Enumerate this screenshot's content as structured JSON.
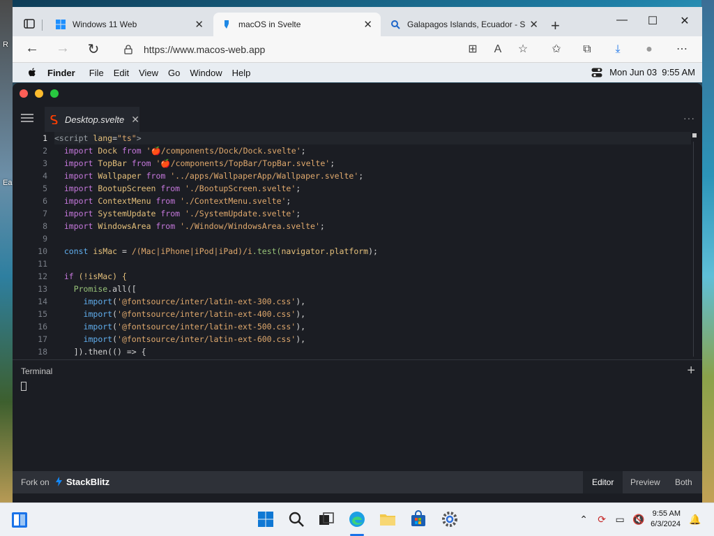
{
  "browser": {
    "tabs": [
      {
        "title": "Windows 11 Web",
        "favicon": "windows-logo-icon"
      },
      {
        "title": "macOS in Svelte",
        "favicon": "svelte-icon",
        "active": true
      },
      {
        "title": "Galapagos Islands, Ecuador - Sea",
        "favicon": "search-icon"
      }
    ],
    "url": "https://www.macos-web.app"
  },
  "desktop": {
    "icon_labels": [
      "R",
      "Ea"
    ]
  },
  "mac_menubar": {
    "app": "Finder",
    "items": [
      "File",
      "Edit",
      "View",
      "Go",
      "Window",
      "Help"
    ],
    "datetime": "Mon Jun 03  9:55 AM"
  },
  "editor": {
    "file_tab": "Desktop.svelte",
    "line_numbers": [
      "1",
      "2",
      "3",
      "4",
      "5",
      "6",
      "7",
      "8",
      "9",
      "10",
      "11",
      "12",
      "13",
      "14",
      "15",
      "16",
      "17",
      "18"
    ],
    "code": {
      "l1": {
        "open": "<script ",
        "attr": "lang",
        "eq": "=",
        "val": "\"ts\"",
        "close": ">"
      },
      "l2": {
        "kw": "import",
        "id": "Dock",
        "from": "from",
        "str": "'🍎/components/Dock/Dock.svelte'",
        "end": ";"
      },
      "l3": {
        "kw": "import",
        "id": "TopBar",
        "from": "from",
        "str": "'🍎/components/TopBar/TopBar.svelte'",
        "end": ";"
      },
      "l4": {
        "kw": "import",
        "id": "Wallpaper",
        "from": "from",
        "str": "'../apps/WallpaperApp/Wallpaper.svelte'",
        "end": ";"
      },
      "l5": {
        "kw": "import",
        "id": "BootupScreen",
        "from": "from",
        "str": "'./BootupScreen.svelte'",
        "end": ";"
      },
      "l6": {
        "kw": "import",
        "id": "ContextMenu",
        "from": "from",
        "str": "'./ContextMenu.svelte'",
        "end": ";"
      },
      "l7": {
        "kw": "import",
        "id": "SystemUpdate",
        "from": "from",
        "str": "'./SystemUpdate.svelte'",
        "end": ";"
      },
      "l8": {
        "kw": "import",
        "id": "WindowsArea",
        "from": "from",
        "str": "'./Window/WindowsArea.svelte'",
        "end": ";"
      },
      "l10": {
        "kw": "const",
        "id": "isMac",
        "eq": " = ",
        "re": "/(Mac|iPhone|iPod|iPad)/i",
        "call": ".test(",
        "arg": "navigator.platform",
        "end": ");"
      },
      "l12": {
        "kw": "if",
        "rest": " (!isMac) {"
      },
      "l13": {
        "id": "Promise",
        "rest": ".all(["
      },
      "l14": {
        "kw": "import",
        "str": "'@fontsource/inter/latin-ext-300.css'",
        "end": "),"
      },
      "l15": {
        "kw": "import",
        "str": "'@fontsource/inter/latin-ext-400.css'",
        "end": "),"
      },
      "l16": {
        "kw": "import",
        "str": "'@fontsource/inter/latin-ext-500.css'",
        "end": "),"
      },
      "l17": {
        "kw": "import",
        "str": "'@fontsource/inter/latin-ext-600.css'",
        "end": "),"
      },
      "l18": {
        "rest": "]).then(() => {"
      }
    }
  },
  "terminal": {
    "title": "Terminal"
  },
  "stackblitz": {
    "fork_label": "Fork on",
    "brand": "StackBlitz",
    "views": [
      "Editor",
      "Preview",
      "Both"
    ]
  },
  "taskbar": {
    "time": "9:55 AM",
    "date": "6/3/2024"
  },
  "colors": {
    "editor_bg": "#1b1d23",
    "keyword": "#c678dd",
    "string": "#e0a96d",
    "identifier": "#e5c07b"
  }
}
